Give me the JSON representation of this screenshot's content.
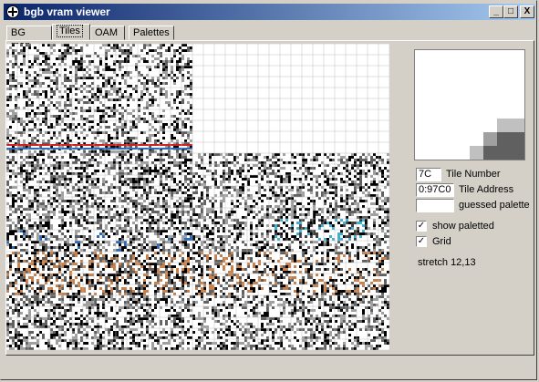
{
  "window": {
    "title": "bgb vram viewer",
    "controls": {
      "minimize": "_",
      "maximize": "□",
      "close": "X"
    }
  },
  "tabs": [
    {
      "label": "BG map",
      "active": false
    },
    {
      "label": "Tiles",
      "active": true
    },
    {
      "label": "OAM",
      "active": false
    },
    {
      "label": "Palettes",
      "active": false
    }
  ],
  "tile_info": {
    "tile_number_value": "7C",
    "tile_number_label": "Tile Number",
    "tile_address_value": "0:97C0",
    "tile_address_label": "Tile Address",
    "palette_value": "",
    "palette_label": "guessed palette"
  },
  "options": {
    "show_paletted_label": "show paletted",
    "show_paletted_checked": true,
    "grid_label": "Grid",
    "grid_checked": true
  },
  "stretch_label": "stretch 12,13",
  "colors": {
    "titlebar_start": "#0a246a",
    "titlebar_end": "#a6caf0",
    "window_bg": "#d4d0c8",
    "tile_orange": "#c8804a",
    "tile_blue": "#2a6ab8",
    "tile_cyan": "#40b0d0",
    "tile_red": "#d02020"
  }
}
